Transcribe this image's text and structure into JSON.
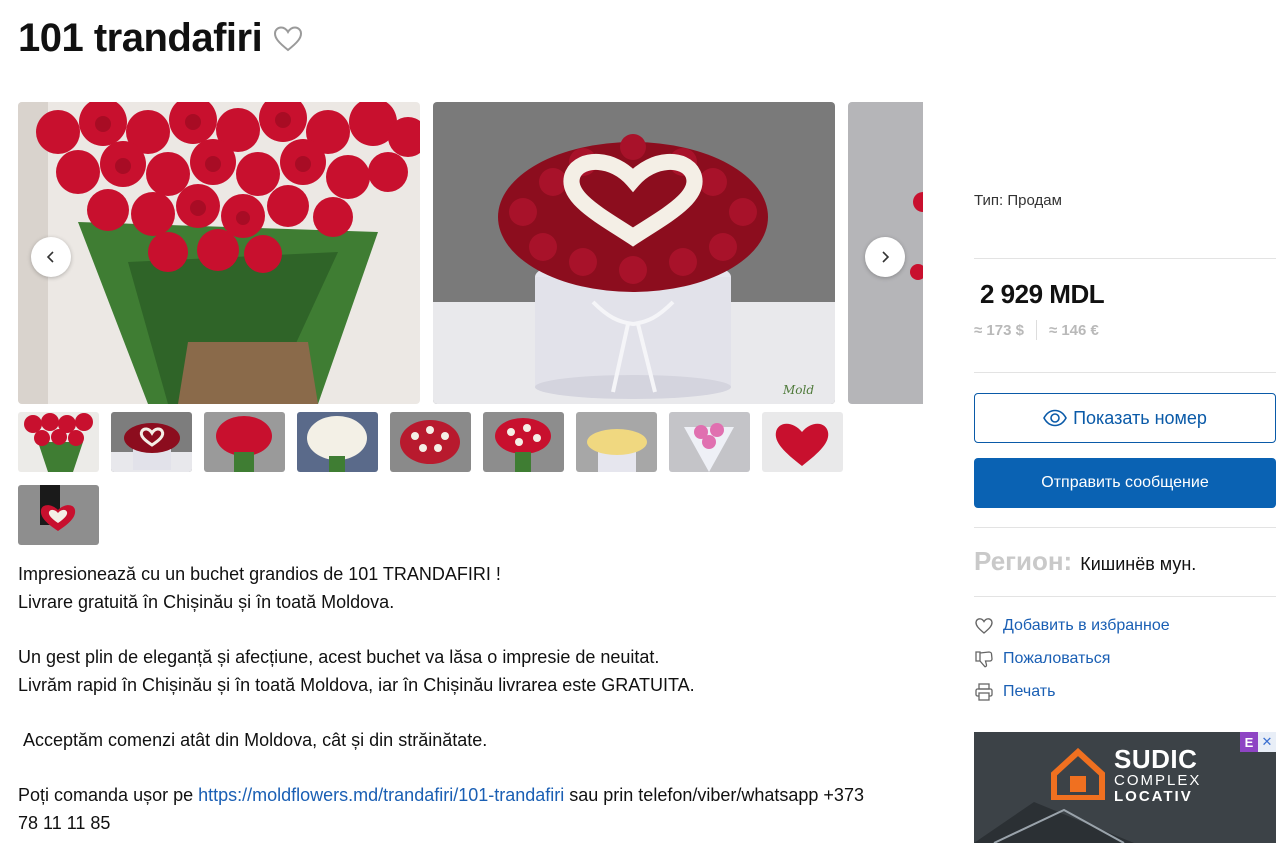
{
  "listing": {
    "title": "101 trandafiri"
  },
  "gallery": {
    "thumbnail_count": 10
  },
  "description": {
    "line1": "Impresionează cu un buchet grandios de 101 TRANDAFIRI !",
    "line2": "Livrare gratuită în Chișinău și în toată Moldova.",
    "line3": "Un gest plin de eleganță și afecțiune, acest buchet va lăsa o impresie de neuitat.",
    "line4": "Livrăm rapid în Chișinău și în toată Moldova, iar în Chișinău livrarea este GRATUITA.",
    "line5": " Acceptăm comenzi atât din Moldova, cât și din străinătate.",
    "line6_prefix": "Poți comanda ușor pe ",
    "line6_link": "https://moldflowers.md/trandafiri/101-trandafiri",
    "line6_suffix": " sau prin telefon/viber/whatsapp +373",
    "line7": "78 11 11 85"
  },
  "sidebar": {
    "type_line": "Тип: Продам",
    "price": "2 929 MDL",
    "price_usd": "≈ 173 $",
    "price_eur": "≈ 146 €",
    "show_phone_label": "Показать номер",
    "send_message_label": "Отправить сообщение",
    "region_label": "Регион:",
    "region_value": "Кишинёв мун.",
    "add_favorite_label": "Добавить в избранное",
    "report_label": "Пожаловаться",
    "print_label": "Печать"
  },
  "ad": {
    "brand_line1": "SUDIC",
    "brand_line2": "COMPLEX",
    "brand_line3": "LOCATIV",
    "badge": "E",
    "close": "✕"
  },
  "colors": {
    "accent": "#0a62b3",
    "link": "#1a5fb4",
    "rose_red": "#c8102e"
  }
}
